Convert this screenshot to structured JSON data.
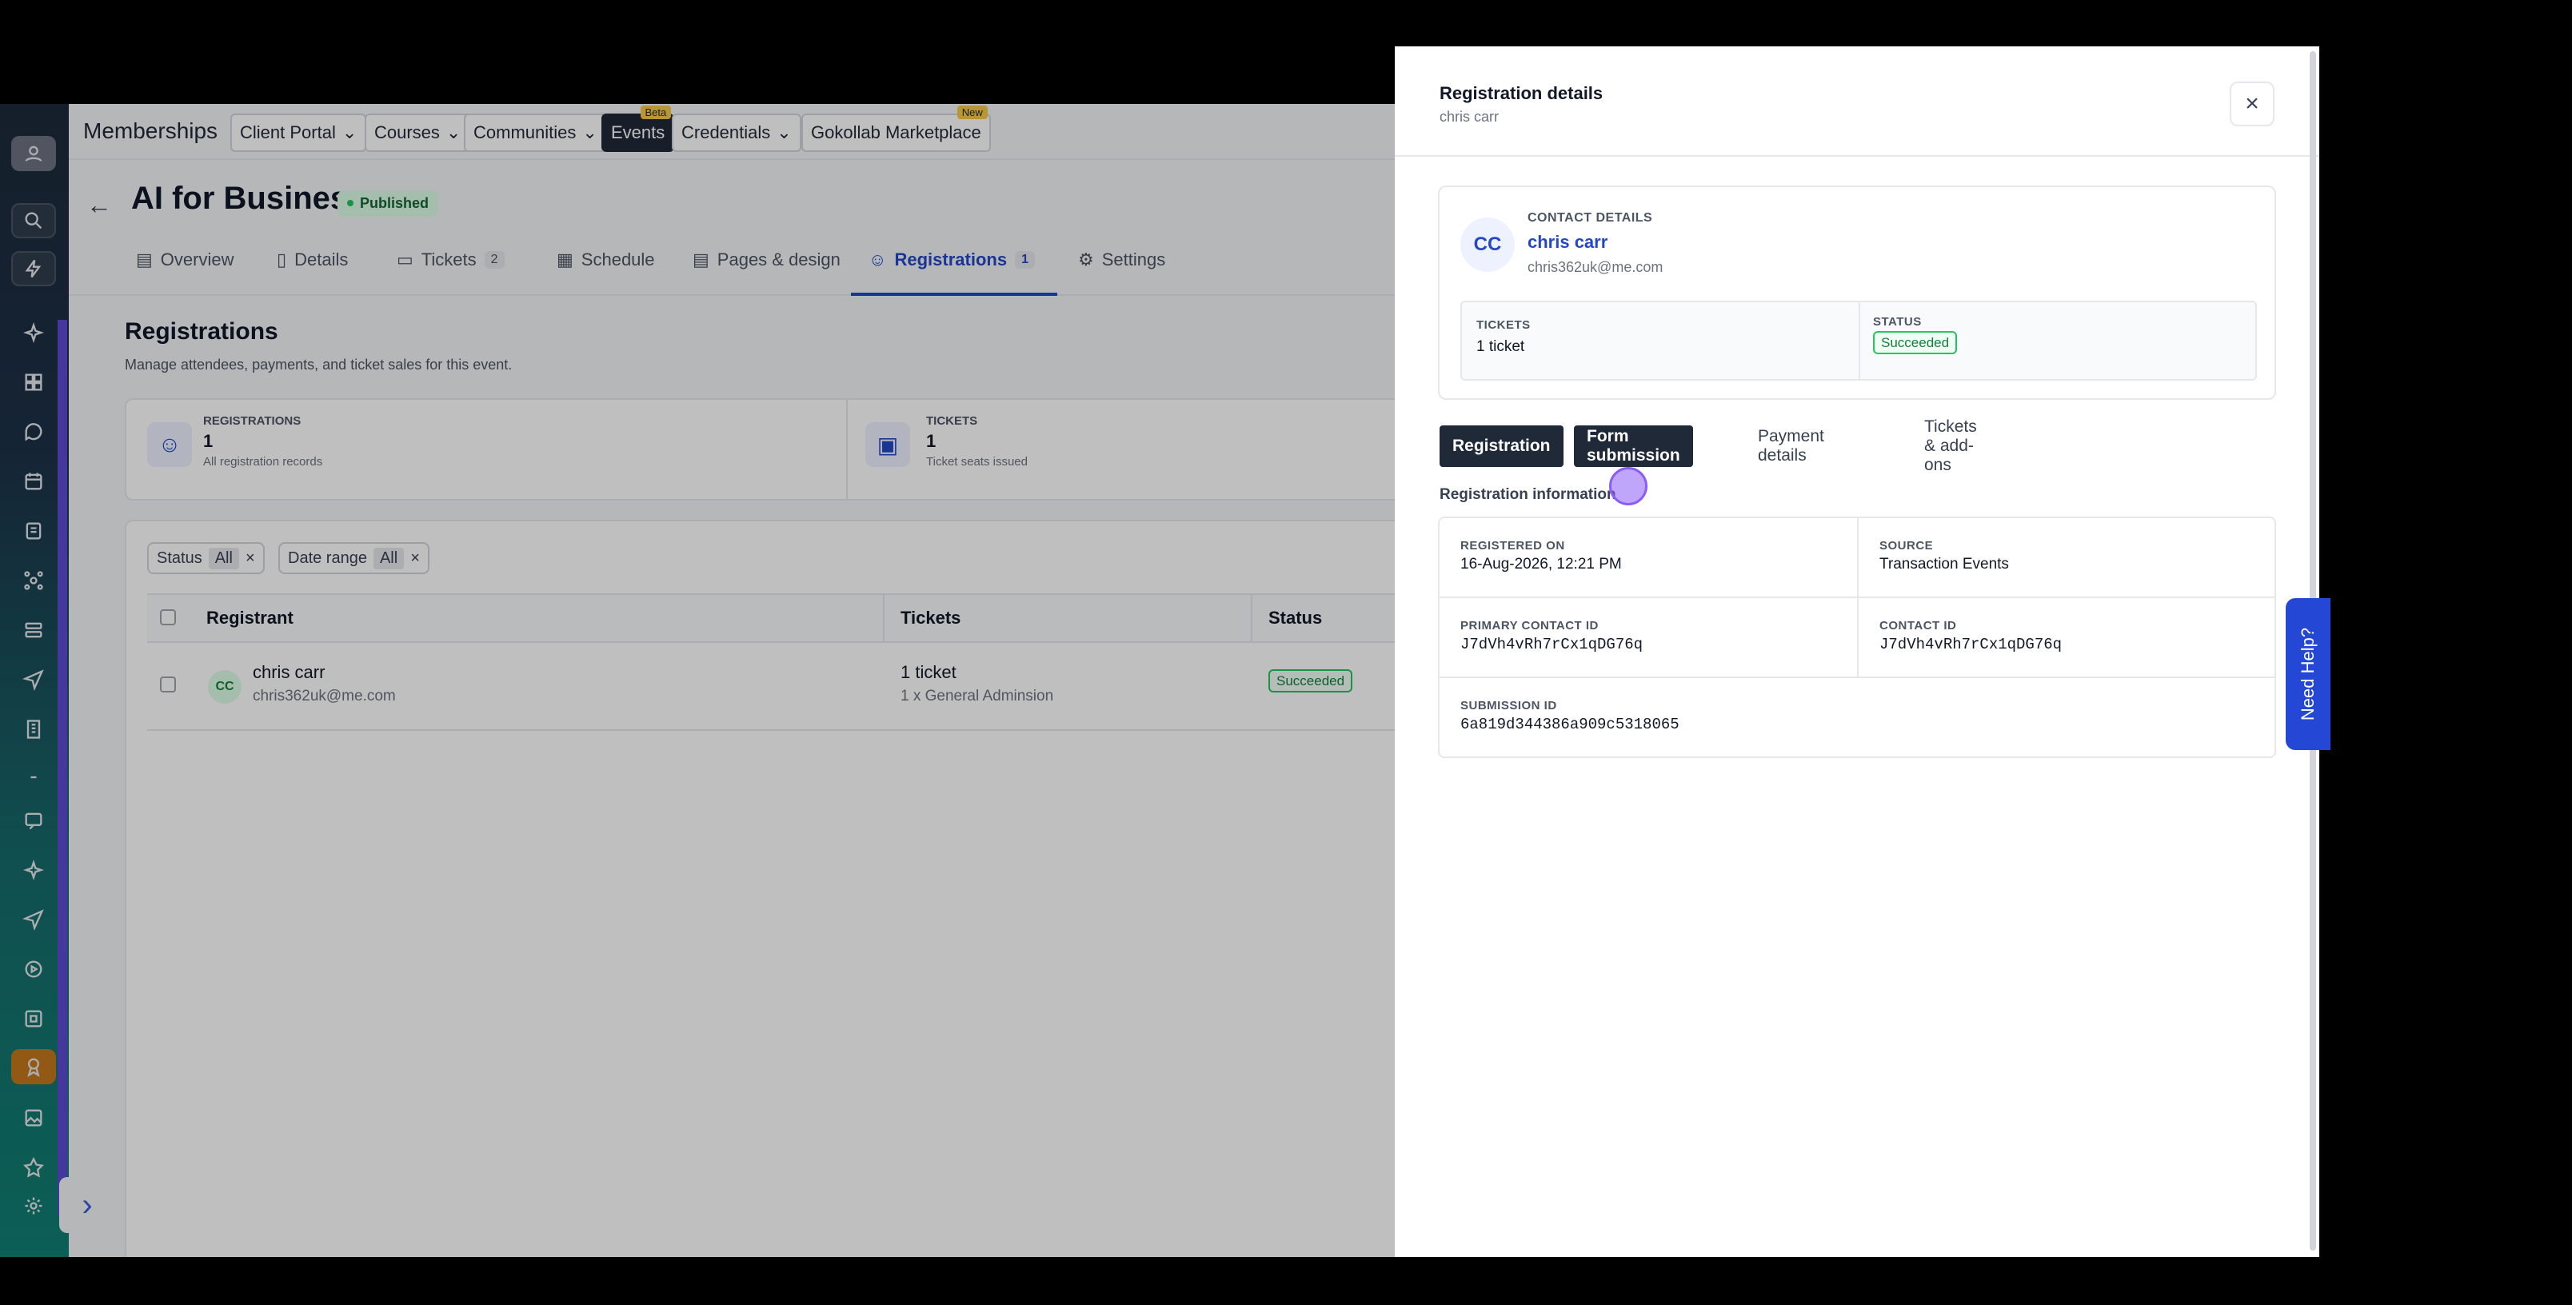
{
  "topnav": {
    "brand": "Memberships",
    "items": [
      {
        "label": "Client Portal"
      },
      {
        "label": "Courses"
      },
      {
        "label": "Communities"
      },
      {
        "label": "Events",
        "tag": "Beta"
      },
      {
        "label": "Credentials"
      },
      {
        "label": "Gokollab Marketplace",
        "tag": "New"
      }
    ]
  },
  "event": {
    "title": "AI for Business",
    "status": "Published"
  },
  "tabs": [
    {
      "label": "Overview"
    },
    {
      "label": "Details"
    },
    {
      "label": "Tickets",
      "count": "2"
    },
    {
      "label": "Schedule"
    },
    {
      "label": "Pages & design"
    },
    {
      "label": "Registrations",
      "count": "1"
    },
    {
      "label": "Settings"
    }
  ],
  "registrations": {
    "title": "Registrations",
    "subtitle": "Manage attendees, payments, and ticket sales for this event.",
    "stats": [
      {
        "label": "REGISTRATIONS",
        "value": "1",
        "sub": "All registration records"
      },
      {
        "label": "TICKETS",
        "value": "1",
        "sub": "Ticket seats issued"
      }
    ],
    "filters": [
      {
        "label": "Status",
        "value": "All"
      },
      {
        "label": "Date range",
        "value": "All"
      }
    ],
    "columns": [
      "Registrant",
      "Tickets",
      "Status"
    ],
    "rows": [
      {
        "initials": "CC",
        "name": "chris carr",
        "email": "chris362uk@me.com",
        "tickets": "1 ticket",
        "ticket_detail": "1 x General Adminsion",
        "status": "Succeeded"
      }
    ]
  },
  "drawer": {
    "title": "Registration details",
    "subtitle": "chris carr",
    "contact": {
      "label": "CONTACT DETAILS",
      "initials": "CC",
      "name": "chris carr",
      "email": "chris362uk@me.com",
      "tickets_label": "TICKETS",
      "tickets_value": "1 ticket",
      "status_label": "STATUS",
      "status_value": "Succeeded"
    },
    "tabs": [
      "Registration",
      "Form submission",
      "Payment details",
      "Tickets & add-ons"
    ],
    "info_title": "Registration information",
    "info": [
      {
        "key": "REGISTERED ON",
        "value": "16-Aug-2026, 12:21 PM"
      },
      {
        "key": "SOURCE",
        "value": "Transaction Events"
      },
      {
        "key": "PRIMARY CONTACT ID",
        "value": "J7dVh4vRh7rCx1qDG76q"
      },
      {
        "key": "CONTACT ID",
        "value": "J7dVh4vRh7rCx1qDG76q"
      },
      {
        "key": "SUBMISSION ID",
        "value": "6a819d344386a909c5318065"
      }
    ]
  },
  "help": {
    "label": "Need Help?"
  },
  "colors": {
    "accent": "#2447c7",
    "success": "#22c55e",
    "dark_tab": "#1f2937",
    "help": "#2447d6"
  }
}
